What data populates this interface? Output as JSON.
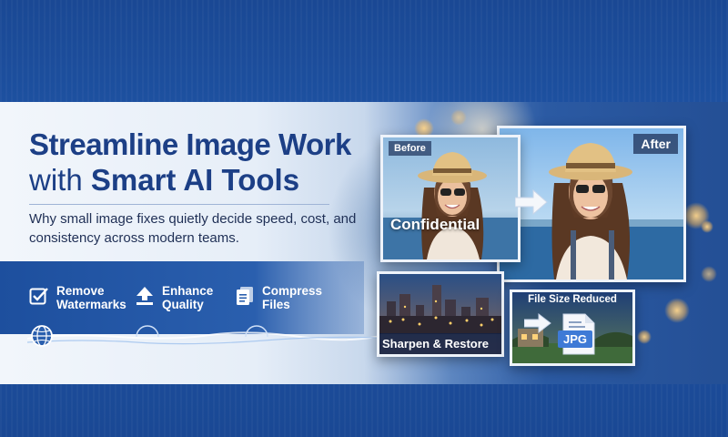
{
  "headline": {
    "line1": "Streamline Image Work",
    "line2_prefix": "with",
    "line2_bold": "Smart AI Tools"
  },
  "subtitle": "Why small image fixes quietly decide speed, cost, and consistency across modern teams.",
  "features": [
    {
      "icon": "checkbox-icon",
      "line1": "Remove",
      "line2": "Watermarks"
    },
    {
      "icon": "upload-arrow-icon",
      "line1": "Enhance",
      "line2": "Quality"
    },
    {
      "icon": "documents-icon",
      "line1": "Compress",
      "line2": "Files"
    }
  ],
  "before_card": {
    "label": "Before",
    "watermark": "Confidential"
  },
  "after_card": {
    "label": "After"
  },
  "sharpen_card": {
    "label": "Sharpen & Restore"
  },
  "compress_card": {
    "title": "File Size Reduced",
    "file_type": "JPG"
  },
  "colors": {
    "brand_blue": "#1c3f86",
    "banner_blue": "#1f56a8",
    "accent_blue": "#3e7ad6"
  }
}
